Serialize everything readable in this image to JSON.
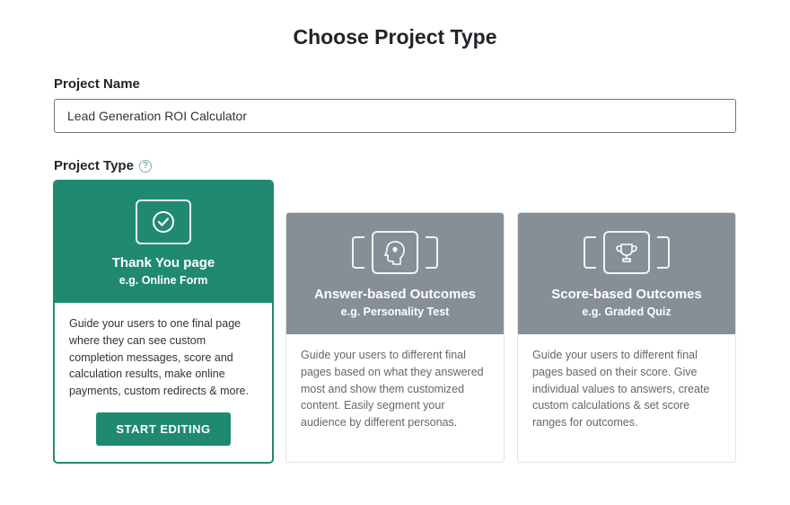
{
  "page_title": "Choose Project Type",
  "project_name": {
    "label": "Project Name",
    "value": "Lead Generation ROI Calculator"
  },
  "project_type": {
    "label": "Project Type",
    "cards": [
      {
        "title": "Thank You page",
        "subtitle": "e.g. Online Form",
        "desc": "Guide your users to one final page where they can see custom completion messages, score and calculation results, make online payments, custom redirects & more.",
        "button": "START EDITING",
        "selected": true
      },
      {
        "title": "Answer-based Outcomes",
        "subtitle": "e.g. Personality Test",
        "desc": "Guide your users to different final pages based on what they answered most and show them customized content. Easily segment your audience by different personas.",
        "selected": false
      },
      {
        "title": "Score-based Outcomes",
        "subtitle": "e.g. Graded Quiz",
        "desc": "Guide your users to different final pages based on their score. Give individual values to answers, create custom calculations & set score ranges for outcomes.",
        "selected": false
      }
    ]
  }
}
